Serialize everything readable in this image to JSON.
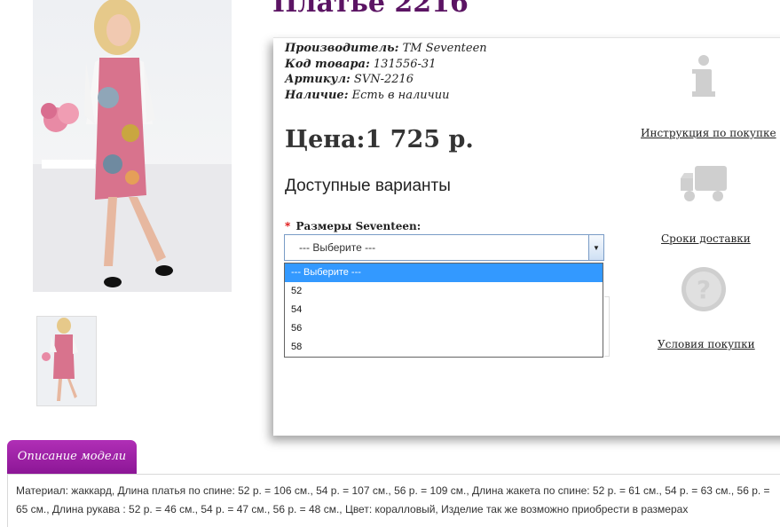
{
  "product": {
    "title": "Платье 2216",
    "specs": [
      {
        "label": "Производитель:",
        "value": "ТМ Seventeen"
      },
      {
        "label": "Код товара:",
        "value": "131556-31"
      },
      {
        "label": "Артикул:",
        "value": "SVN-2216"
      },
      {
        "label": "Наличие:",
        "value": "Есть в наличии"
      }
    ],
    "price": "Цена:1 725 р."
  },
  "options": {
    "title": "Доступные варианты",
    "required_mark": "*",
    "size_label": "Размеры Seventeen:",
    "select_value": "--- Выберите ---",
    "dropdown": [
      "--- Выберите ---",
      "52",
      "54",
      "56",
      "58"
    ]
  },
  "sidebar": {
    "links": [
      {
        "label": "Инструкция по покупке",
        "icon": "info-icon"
      },
      {
        "label": "Сроки доставки",
        "icon": "truck-icon"
      },
      {
        "label": "Условия покупки",
        "icon": "question-icon"
      }
    ]
  },
  "description": {
    "tab_label": "Описание модели",
    "text": "Материал: жаккард, Длина платья по спине: 52 р. = 106 см., 54 р. = 107 см., 56 р. = 109 см., Длина жакета по спине: 52 р. = 61 см., 54 р. = 63 см., 56 р. = 65 см., Длина рукава : 52 р. = 46 см., 54 р. = 47 см., 56 р. = 48 см., Цвет: коралловый, Изделие так же возможно приобрести в размерах"
  },
  "colors": {
    "title": "#5b1463",
    "tab": "#9b21a4",
    "selected_option": "#3399ff",
    "icon_gray": "#cfcfcf"
  }
}
